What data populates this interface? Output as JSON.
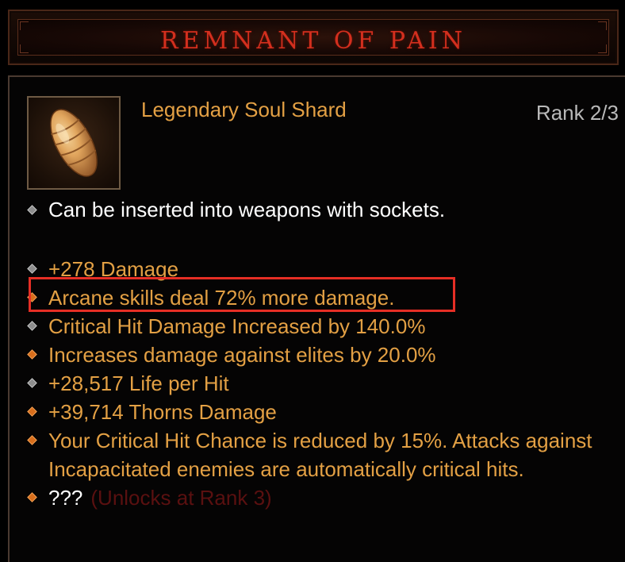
{
  "item": {
    "name": "REMNANT OF PAIN",
    "rarity_type": "Legendary Soul Shard",
    "rank": "Rank 2/3",
    "icon": "soul-shard-icon"
  },
  "description": "Can be inserted into weapons with sockets.",
  "affixes": [
    {
      "text": "+278 Damage",
      "bullet": "grey"
    },
    {
      "text": "Arcane skills deal 72% more damage.",
      "bullet": "orange"
    },
    {
      "text": "Critical Hit Damage Increased by 140.0%",
      "bullet": "grey"
    },
    {
      "text": "Increases damage against elites by 20.0%",
      "bullet": "orange"
    },
    {
      "text": "+28,517 Life per Hit",
      "bullet": "grey"
    },
    {
      "text": "+39,714 Thorns Damage",
      "bullet": "orange"
    },
    {
      "text": "Your Critical Hit Chance is reduced by 15%. Attacks against Incapacitated enemies are automatically critical hits.",
      "bullet": "orange"
    }
  ],
  "locked_affix": {
    "text": "???",
    "requirement": "(Unlocks at Rank 3)"
  },
  "colors": {
    "title": "#d32f1e",
    "affix": "#e3a044",
    "rank": "#b9b9b9",
    "highlight": "#e62e25",
    "bullet_grey": "#8e8e8e",
    "bullet_orange": "#d86e1c"
  }
}
